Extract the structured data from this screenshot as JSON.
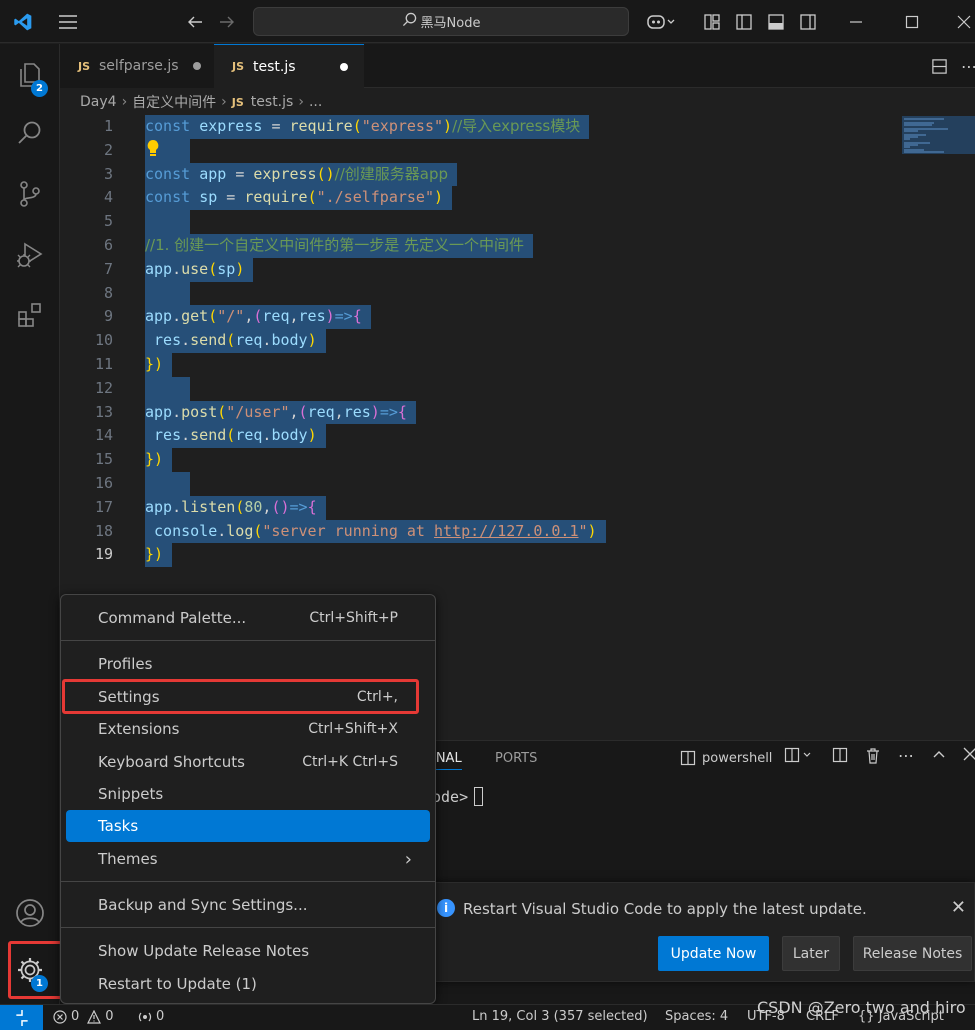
{
  "titlebar": {
    "search_text": "黑马Node"
  },
  "activity": {
    "explorer_badge": "2",
    "manage_badge": "1"
  },
  "tabs": [
    {
      "icon_text": "JS",
      "label": "selfparse.js"
    },
    {
      "icon_text": "JS",
      "label": "test.js"
    }
  ],
  "breadcrumb": {
    "folder": "Day4",
    "subfolder": "自定义中间件",
    "file_icon": "JS",
    "file": "test.js",
    "more": "..."
  },
  "editor": {
    "line_numbers": [
      "1",
      "2",
      "3",
      "4",
      "5",
      "6",
      "7",
      "8",
      "9",
      "10",
      "11",
      "12",
      "13",
      "14",
      "15",
      "16",
      "17",
      "18",
      "19"
    ],
    "code_lines": [
      "const express = require(\"express\")//导入express模块",
      "",
      "const app = express()//创建服务器app",
      "const sp = require(\"./selfparse\")",
      "",
      "//1. 创建一个自定义中间件的第一步是 先定义一个中间件",
      "app.use(sp)",
      "",
      "app.get(\"/\",(req,res)=>{",
      " res.send(req.body)",
      "})",
      "",
      "app.post(\"/user\",(req,res)=>{",
      " res.send(req.body)",
      "})",
      "",
      "app.listen(80,()=>{",
      " console.log(\"server running at http://127.0.0.1\")",
      "})"
    ]
  },
  "menu": {
    "items": [
      {
        "label": "Command Palette...",
        "shortcut": "Ctrl+Shift+P"
      },
      {
        "label": "Profiles",
        "shortcut": ""
      },
      {
        "label": "Settings",
        "shortcut": "Ctrl+,"
      },
      {
        "label": "Extensions",
        "shortcut": "Ctrl+Shift+X"
      },
      {
        "label": "Keyboard Shortcuts",
        "shortcut": "Ctrl+K Ctrl+S"
      },
      {
        "label": "Snippets",
        "shortcut": ""
      },
      {
        "label": "Tasks",
        "shortcut": ""
      },
      {
        "label": "Themes",
        "shortcut": "›"
      },
      {
        "label": "Backup and Sync Settings...",
        "shortcut": ""
      },
      {
        "label": "Show Update Release Notes",
        "shortcut": ""
      },
      {
        "label": "Restart to Update (1)",
        "shortcut": ""
      }
    ]
  },
  "panel": {
    "tab_terminal_partial": "INAL",
    "tab_ports": "PORTS",
    "shell_name": "powershell",
    "prompt_partial": "ode>"
  },
  "notification": {
    "message": "Restart Visual Studio Code to apply the latest update.",
    "update_now": "Update Now",
    "later": "Later",
    "release_notes": "Release Notes"
  },
  "statusbar": {
    "errors": "0",
    "warnings": "0",
    "ports": "0",
    "position": "Ln 19, Col 3 (357 selected)",
    "spaces": "Spaces: 4",
    "encoding": "UTF-8",
    "eol": "CRLF",
    "language": "{} JavaScript"
  },
  "watermark": "CSDN @Zero two and hiro",
  "colors": {
    "accent": "#0078d4",
    "highlight_box": "#e53935",
    "selection": "#264f78"
  }
}
